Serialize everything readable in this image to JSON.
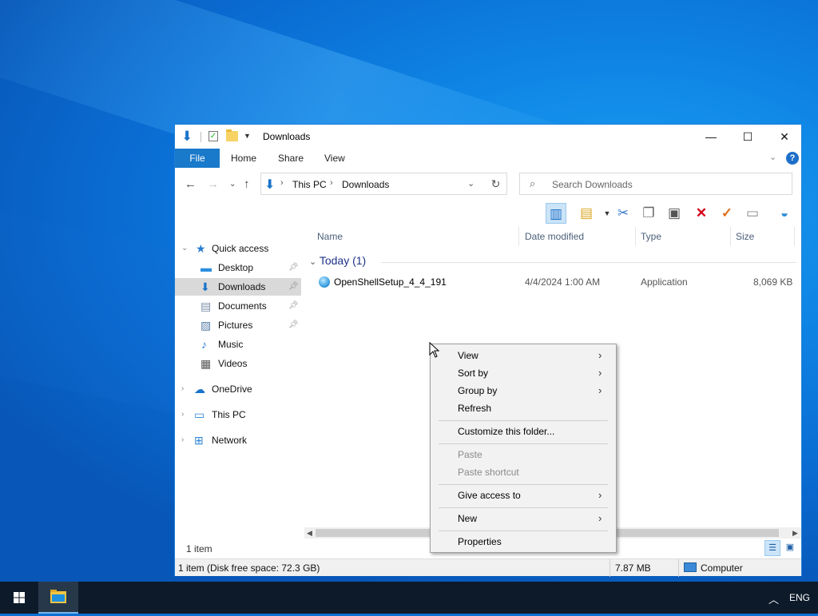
{
  "window": {
    "title": "Downloads",
    "minimize": "—",
    "maximize": "☐",
    "close": "✕"
  },
  "ribbon": {
    "tabs": [
      "File",
      "Home",
      "Share",
      "View"
    ],
    "help": "?"
  },
  "address": {
    "crumbs": [
      "This PC",
      "Downloads"
    ],
    "search_placeholder": "Search Downloads"
  },
  "nav": {
    "items": [
      {
        "label": "Quick access"
      },
      {
        "label": "Desktop"
      },
      {
        "label": "Downloads"
      },
      {
        "label": "Documents"
      },
      {
        "label": "Pictures"
      },
      {
        "label": "Music"
      },
      {
        "label": "Videos"
      },
      {
        "label": "OneDrive"
      },
      {
        "label": "This PC"
      },
      {
        "label": "Network"
      }
    ]
  },
  "columns": [
    "Name",
    "Date modified",
    "Type",
    "Size"
  ],
  "group": {
    "label": "Today (1)"
  },
  "files": [
    {
      "name": "OpenShellSetup_4_4_191",
      "date": "4/4/2024 1:00 AM",
      "type": "Application",
      "size": "8,069 KB"
    }
  ],
  "item_count": "1 item",
  "status": {
    "disk": "1 item (Disk free space: 72.3 GB)",
    "size": "7.87 MB",
    "location": "Computer"
  },
  "context_menu": {
    "items": [
      "View",
      "Sort by",
      "Group by",
      "Refresh",
      "Customize this folder...",
      "Paste",
      "Paste shortcut",
      "Give access to",
      "New",
      "Properties"
    ]
  },
  "taskbar": {
    "language": "ENG"
  },
  "colors": {
    "accent": "#1979ca",
    "group_header": "#1e3287",
    "desktop": "#0f86e6"
  }
}
